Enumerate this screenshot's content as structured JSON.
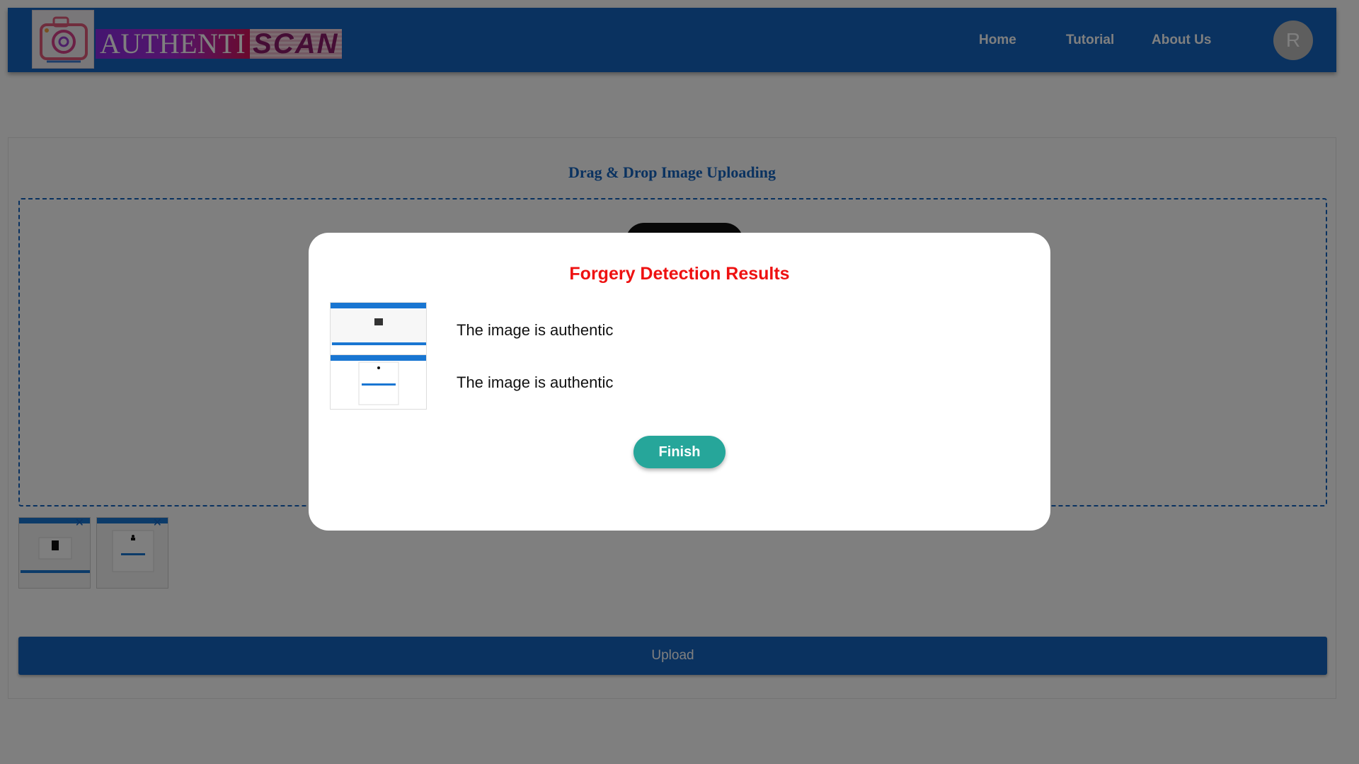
{
  "brand": {
    "name_part1": "AUTHENTI",
    "name_part2": "SCAN",
    "logo_icon": "camera-icon"
  },
  "nav": {
    "links": [
      "Home",
      "Tutorial",
      "About Us"
    ],
    "avatar_initial": "R"
  },
  "uploader": {
    "title": "Drag & Drop Image Uploading",
    "upload_label": "Upload",
    "dropzone_icon": "image-icon",
    "thumbnail_close_icon": "close-icon"
  },
  "modal": {
    "title": "Forgery Detection Results",
    "results": [
      {
        "text": "The image is authentic"
      },
      {
        "text": "The image is authentic"
      }
    ],
    "finish_label": "Finish"
  },
  "colors": {
    "navbar": "#1565c0",
    "modal_title": "#ee1111",
    "finish_button": "#26a69a",
    "overlay": "rgba(0,0,0,0.5)"
  }
}
